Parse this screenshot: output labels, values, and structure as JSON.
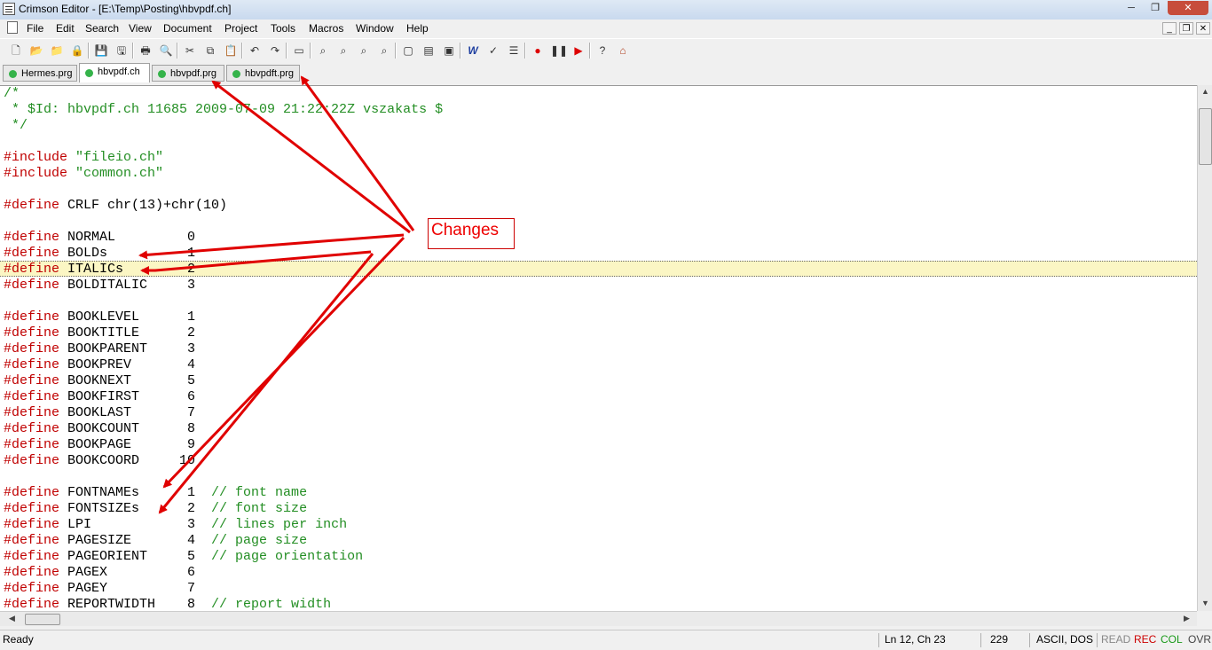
{
  "window": {
    "title": "Crimson Editor - [E:\\Temp\\Posting\\hbvpdf.ch]",
    "min": "─",
    "max": "❐",
    "close": "✕"
  },
  "menu": [
    "File",
    "Edit",
    "Search",
    "View",
    "Document",
    "Project",
    "Tools",
    "Macros",
    "Window",
    "Help"
  ],
  "mdi": {
    "min": "_",
    "restore": "❐",
    "close": "✕"
  },
  "toolbar": [
    {
      "name": "new-file-icon",
      "glyph": "🗋"
    },
    {
      "name": "open-file-icon",
      "glyph": "📂"
    },
    {
      "name": "open-remote-icon",
      "glyph": "📁"
    },
    {
      "name": "lock-icon",
      "glyph": "🔒"
    },
    {
      "name": "save-icon",
      "glyph": "💾"
    },
    {
      "name": "save-all-icon",
      "glyph": "🖫"
    },
    {
      "name": "print-icon",
      "glyph": "🖶"
    },
    {
      "name": "print-preview-icon",
      "glyph": "🔍"
    },
    {
      "name": "cut-icon",
      "glyph": "✂"
    },
    {
      "name": "copy-icon",
      "glyph": "⧉"
    },
    {
      "name": "paste-icon",
      "glyph": "📋"
    },
    {
      "name": "undo-icon",
      "glyph": "↶"
    },
    {
      "name": "redo-icon",
      "glyph": "↷"
    },
    {
      "name": "window-icon",
      "glyph": "▭"
    },
    {
      "name": "find-icon",
      "glyph": "⌕"
    },
    {
      "name": "find-next-icon",
      "glyph": "⌕"
    },
    {
      "name": "find-prev-icon",
      "glyph": "⌕"
    },
    {
      "name": "replace-icon",
      "glyph": "⌕"
    },
    {
      "name": "window-list-icon",
      "glyph": "▢"
    },
    {
      "name": "tile-icon",
      "glyph": "▤"
    },
    {
      "name": "screen-icon",
      "glyph": "▣"
    },
    {
      "name": "word-wrap-icon",
      "glyph": "W"
    },
    {
      "name": "spell-check-icon",
      "glyph": "✓"
    },
    {
      "name": "line-numbers-icon",
      "glyph": "☰"
    },
    {
      "name": "record-macro-icon",
      "glyph": "●"
    },
    {
      "name": "pause-macro-icon",
      "glyph": "❚❚"
    },
    {
      "name": "play-macro-icon",
      "glyph": "▶"
    },
    {
      "name": "help-icon",
      "glyph": "?"
    },
    {
      "name": "home-icon",
      "glyph": "⌂"
    }
  ],
  "tabs": [
    "Hermes.prg",
    "hbvpdf.ch",
    "hbvpdf.prg",
    "hbvpdft.prg"
  ],
  "code": [
    [
      [
        "c-cm",
        "/*"
      ]
    ],
    [
      [
        "c-cm",
        " * $Id: hbvpdf.ch 11685 2009-07-09 21:22:22Z vszakats $"
      ]
    ],
    [
      [
        "c-cm",
        " */"
      ]
    ],
    [],
    [
      [
        "c-pp",
        "#include "
      ],
      [
        "c-st",
        "\"fileio.ch\""
      ]
    ],
    [
      [
        "c-pp",
        "#include "
      ],
      [
        "c-st",
        "\"common.ch\""
      ]
    ],
    [],
    [
      [
        "c-pp",
        "#define "
      ],
      [
        "c-tx",
        "CRLF chr(13)+chr(10)"
      ]
    ],
    [],
    [
      [
        "c-pp",
        "#define "
      ],
      [
        "c-tx",
        "NORMAL         0"
      ]
    ],
    [
      [
        "c-pp",
        "#define "
      ],
      [
        "c-tx",
        "BOLDs          1"
      ]
    ],
    [
      [
        "c-pp",
        "#define "
      ],
      [
        "c-tx",
        "ITALICs        2"
      ]
    ],
    [
      [
        "c-pp",
        "#define "
      ],
      [
        "c-tx",
        "BOLDITALIC     3"
      ]
    ],
    [],
    [
      [
        "c-pp",
        "#define "
      ],
      [
        "c-tx",
        "BOOKLEVEL      1"
      ]
    ],
    [
      [
        "c-pp",
        "#define "
      ],
      [
        "c-tx",
        "BOOKTITLE      2"
      ]
    ],
    [
      [
        "c-pp",
        "#define "
      ],
      [
        "c-tx",
        "BOOKPARENT     3"
      ]
    ],
    [
      [
        "c-pp",
        "#define "
      ],
      [
        "c-tx",
        "BOOKPREV       4"
      ]
    ],
    [
      [
        "c-pp",
        "#define "
      ],
      [
        "c-tx",
        "BOOKNEXT       5"
      ]
    ],
    [
      [
        "c-pp",
        "#define "
      ],
      [
        "c-tx",
        "BOOKFIRST      6"
      ]
    ],
    [
      [
        "c-pp",
        "#define "
      ],
      [
        "c-tx",
        "BOOKLAST       7"
      ]
    ],
    [
      [
        "c-pp",
        "#define "
      ],
      [
        "c-tx",
        "BOOKCOUNT      8"
      ]
    ],
    [
      [
        "c-pp",
        "#define "
      ],
      [
        "c-tx",
        "BOOKPAGE       9"
      ]
    ],
    [
      [
        "c-pp",
        "#define "
      ],
      [
        "c-tx",
        "BOOKCOORD     10"
      ]
    ],
    [],
    [
      [
        "c-pp",
        "#define "
      ],
      [
        "c-tx",
        "FONTNAMEs      1  "
      ],
      [
        "c-cm",
        "// font name"
      ]
    ],
    [
      [
        "c-pp",
        "#define "
      ],
      [
        "c-tx",
        "FONTSIZEs      2  "
      ],
      [
        "c-cm",
        "// font size"
      ]
    ],
    [
      [
        "c-pp",
        "#define "
      ],
      [
        "c-tx",
        "LPI            3  "
      ],
      [
        "c-cm",
        "// lines per inch"
      ]
    ],
    [
      [
        "c-pp",
        "#define "
      ],
      [
        "c-tx",
        "PAGESIZE       4  "
      ],
      [
        "c-cm",
        "// page size"
      ]
    ],
    [
      [
        "c-pp",
        "#define "
      ],
      [
        "c-tx",
        "PAGEORIENT     5  "
      ],
      [
        "c-cm",
        "// page orientation"
      ]
    ],
    [
      [
        "c-pp",
        "#define "
      ],
      [
        "c-tx",
        "PAGEX          6"
      ]
    ],
    [
      [
        "c-pp",
        "#define "
      ],
      [
        "c-tx",
        "PAGEY          7"
      ]
    ],
    [
      [
        "c-pp",
        "#define "
      ],
      [
        "c-tx",
        "REPORTWIDTH    8  "
      ],
      [
        "c-cm",
        "// report width"
      ]
    ]
  ],
  "highlight_line": 12,
  "callout": {
    "text": "Changes"
  },
  "status": {
    "ready": "Ready",
    "position": "Ln 12, Ch 23",
    "count": "229",
    "encoding": "ASCII, DOS",
    "read": "READ",
    "rec": "REC",
    "col": "COL",
    "ovr": "OVR"
  },
  "colors": {
    "preprocessor": "#c00000",
    "comment": "#238e23",
    "highlight": "#fbf6c4",
    "arrow": "#e00000"
  }
}
